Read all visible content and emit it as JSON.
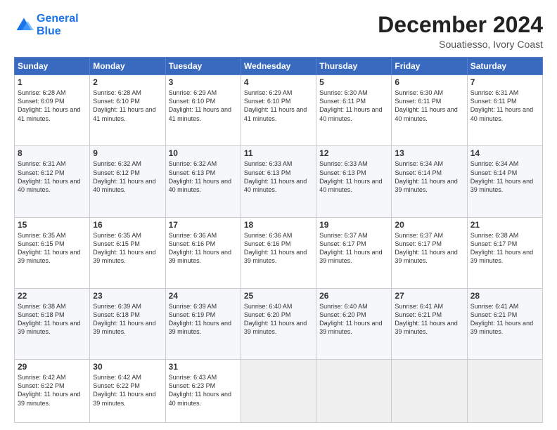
{
  "logo": {
    "line1": "General",
    "line2": "Blue"
  },
  "title": "December 2024",
  "subtitle": "Souatiesso, Ivory Coast",
  "days_of_week": [
    "Sunday",
    "Monday",
    "Tuesday",
    "Wednesday",
    "Thursday",
    "Friday",
    "Saturday"
  ],
  "weeks": [
    [
      {
        "day": "1",
        "sunrise": "6:28 AM",
        "sunset": "6:09 PM",
        "daylight": "11 hours and 41 minutes."
      },
      {
        "day": "2",
        "sunrise": "6:28 AM",
        "sunset": "6:10 PM",
        "daylight": "11 hours and 41 minutes."
      },
      {
        "day": "3",
        "sunrise": "6:29 AM",
        "sunset": "6:10 PM",
        "daylight": "11 hours and 41 minutes."
      },
      {
        "day": "4",
        "sunrise": "6:29 AM",
        "sunset": "6:10 PM",
        "daylight": "11 hours and 41 minutes."
      },
      {
        "day": "5",
        "sunrise": "6:30 AM",
        "sunset": "6:11 PM",
        "daylight": "11 hours and 40 minutes."
      },
      {
        "day": "6",
        "sunrise": "6:30 AM",
        "sunset": "6:11 PM",
        "daylight": "11 hours and 40 minutes."
      },
      {
        "day": "7",
        "sunrise": "6:31 AM",
        "sunset": "6:11 PM",
        "daylight": "11 hours and 40 minutes."
      }
    ],
    [
      {
        "day": "8",
        "sunrise": "6:31 AM",
        "sunset": "6:12 PM",
        "daylight": "11 hours and 40 minutes."
      },
      {
        "day": "9",
        "sunrise": "6:32 AM",
        "sunset": "6:12 PM",
        "daylight": "11 hours and 40 minutes."
      },
      {
        "day": "10",
        "sunrise": "6:32 AM",
        "sunset": "6:13 PM",
        "daylight": "11 hours and 40 minutes."
      },
      {
        "day": "11",
        "sunrise": "6:33 AM",
        "sunset": "6:13 PM",
        "daylight": "11 hours and 40 minutes."
      },
      {
        "day": "12",
        "sunrise": "6:33 AM",
        "sunset": "6:13 PM",
        "daylight": "11 hours and 40 minutes."
      },
      {
        "day": "13",
        "sunrise": "6:34 AM",
        "sunset": "6:14 PM",
        "daylight": "11 hours and 39 minutes."
      },
      {
        "day": "14",
        "sunrise": "6:34 AM",
        "sunset": "6:14 PM",
        "daylight": "11 hours and 39 minutes."
      }
    ],
    [
      {
        "day": "15",
        "sunrise": "6:35 AM",
        "sunset": "6:15 PM",
        "daylight": "11 hours and 39 minutes."
      },
      {
        "day": "16",
        "sunrise": "6:35 AM",
        "sunset": "6:15 PM",
        "daylight": "11 hours and 39 minutes."
      },
      {
        "day": "17",
        "sunrise": "6:36 AM",
        "sunset": "6:16 PM",
        "daylight": "11 hours and 39 minutes."
      },
      {
        "day": "18",
        "sunrise": "6:36 AM",
        "sunset": "6:16 PM",
        "daylight": "11 hours and 39 minutes."
      },
      {
        "day": "19",
        "sunrise": "6:37 AM",
        "sunset": "6:17 PM",
        "daylight": "11 hours and 39 minutes."
      },
      {
        "day": "20",
        "sunrise": "6:37 AM",
        "sunset": "6:17 PM",
        "daylight": "11 hours and 39 minutes."
      },
      {
        "day": "21",
        "sunrise": "6:38 AM",
        "sunset": "6:17 PM",
        "daylight": "11 hours and 39 minutes."
      }
    ],
    [
      {
        "day": "22",
        "sunrise": "6:38 AM",
        "sunset": "6:18 PM",
        "daylight": "11 hours and 39 minutes."
      },
      {
        "day": "23",
        "sunrise": "6:39 AM",
        "sunset": "6:18 PM",
        "daylight": "11 hours and 39 minutes."
      },
      {
        "day": "24",
        "sunrise": "6:39 AM",
        "sunset": "6:19 PM",
        "daylight": "11 hours and 39 minutes."
      },
      {
        "day": "25",
        "sunrise": "6:40 AM",
        "sunset": "6:20 PM",
        "daylight": "11 hours and 39 minutes."
      },
      {
        "day": "26",
        "sunrise": "6:40 AM",
        "sunset": "6:20 PM",
        "daylight": "11 hours and 39 minutes."
      },
      {
        "day": "27",
        "sunrise": "6:41 AM",
        "sunset": "6:21 PM",
        "daylight": "11 hours and 39 minutes."
      },
      {
        "day": "28",
        "sunrise": "6:41 AM",
        "sunset": "6:21 PM",
        "daylight": "11 hours and 39 minutes."
      }
    ],
    [
      {
        "day": "29",
        "sunrise": "6:42 AM",
        "sunset": "6:22 PM",
        "daylight": "11 hours and 39 minutes."
      },
      {
        "day": "30",
        "sunrise": "6:42 AM",
        "sunset": "6:22 PM",
        "daylight": "11 hours and 39 minutes."
      },
      {
        "day": "31",
        "sunrise": "6:43 AM",
        "sunset": "6:23 PM",
        "daylight": "11 hours and 40 minutes."
      },
      null,
      null,
      null,
      null
    ]
  ]
}
